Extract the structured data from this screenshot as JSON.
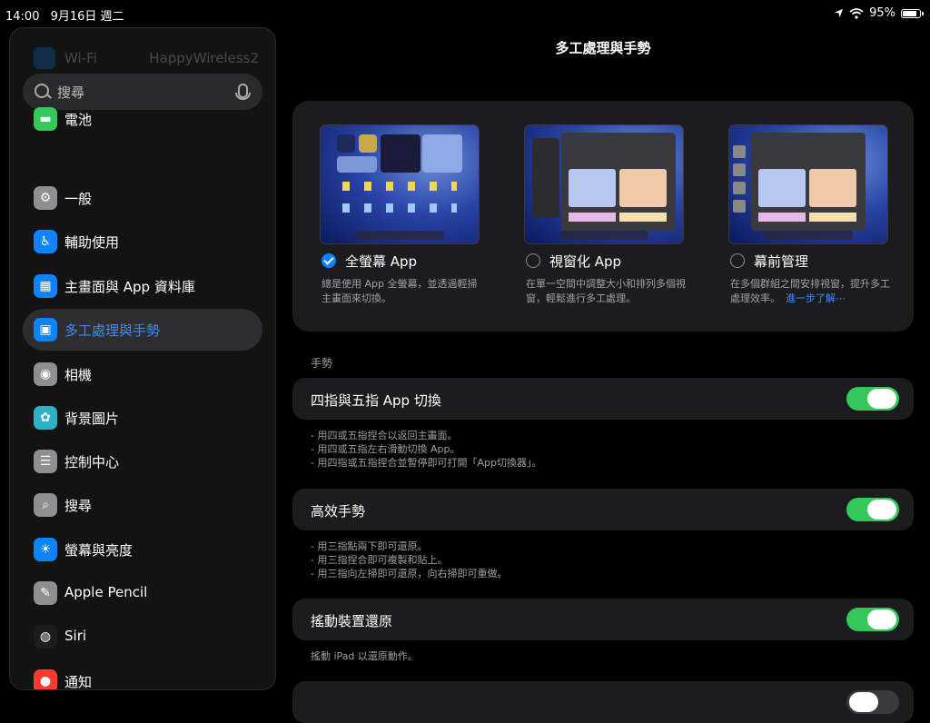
{
  "status": {
    "time": "14:00",
    "date": "9月16日 週二",
    "battery": "95%",
    "battery_level": 0.95
  },
  "sidebar": {
    "ghost": {
      "label": "Wi-Fi",
      "value": "HappyWireless2"
    },
    "search": {
      "placeholder": "搜尋"
    },
    "items": [
      {
        "label": "電池",
        "icon": "battery-icon",
        "color": "#34c759",
        "selected": false
      },
      {
        "label": "一般",
        "icon": "gear-icon",
        "color": "#8e8e93",
        "selected": false
      },
      {
        "label": "輔助使用",
        "icon": "accessibility-icon",
        "color": "#0a84ff",
        "selected": false
      },
      {
        "label": "主畫面與 App 資料庫",
        "icon": "home-screen-icon",
        "color": "#0a84ff",
        "selected": false
      },
      {
        "label": "多工處理與手勢",
        "icon": "multitasking-icon",
        "color": "#0a84ff",
        "selected": true
      },
      {
        "label": "相機",
        "icon": "camera-icon",
        "color": "#8e8e93",
        "selected": false
      },
      {
        "label": "背景圖片",
        "icon": "wallpaper-icon",
        "color": "#30b0c7",
        "selected": false
      },
      {
        "label": "控制中心",
        "icon": "control-center-icon",
        "color": "#8e8e93",
        "selected": false
      },
      {
        "label": "搜尋",
        "icon": "search-icon",
        "color": "#8e8e93",
        "selected": false
      },
      {
        "label": "螢幕與亮度",
        "icon": "brightness-icon",
        "color": "#0a84ff",
        "selected": false
      },
      {
        "label": "Apple Pencil",
        "icon": "pencil-icon",
        "color": "#8e8e93",
        "selected": false
      },
      {
        "label": "Siri",
        "icon": "siri-icon",
        "color": "#1c1c1e",
        "selected": false
      },
      {
        "label": "通知",
        "icon": "notifications-icon",
        "color": "#ff3b30",
        "selected": false
      }
    ]
  },
  "main": {
    "title": "多工處理與手勢",
    "modes": [
      {
        "label": "全螢幕 App",
        "checked": true,
        "desc": "總是使用 App 全螢幕，並透過輕掃主畫面來切換。",
        "link": ""
      },
      {
        "label": "視窗化 App",
        "checked": false,
        "desc": "在單一空間中調整大小和排列多個視窗，輕鬆進行多工處理。",
        "link": ""
      },
      {
        "label": "幕前管理",
        "checked": false,
        "desc": "在多個群組之間安排視窗，提升多工處理效率。",
        "link": "進一步了解⋯"
      }
    ],
    "gestures_header": "手勢",
    "toggles": [
      {
        "label": "四指與五指 App 切換",
        "on": true,
        "notes": [
          "- 用四或五指捏合以返回主畫面。",
          "- 用四或五指左右滑動切換 App。",
          "- 用四指或五指捏合並暫停即可打開「App切換器」。"
        ]
      },
      {
        "label": "高效手勢",
        "on": true,
        "notes": [
          "- 用三指點兩下即可還原。",
          "- 用三指捏合即可複製和貼上。",
          "- 用三指向左掃即可還原，向右掃即可重做。"
        ]
      },
      {
        "label": "搖動裝置還原",
        "on": true,
        "notes": [
          "搖動 iPad 以還原動作。"
        ]
      },
      {
        "label": "",
        "on": false,
        "notes": []
      }
    ]
  }
}
